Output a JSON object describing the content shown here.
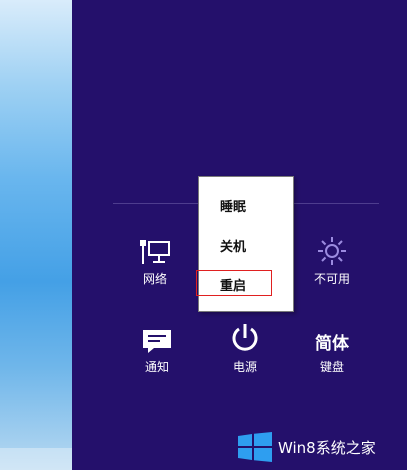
{
  "power_menu": {
    "items": [
      {
        "label": "睡眠"
      },
      {
        "label": "关机"
      },
      {
        "label": "重启"
      }
    ]
  },
  "settings_tiles": {
    "network_label": "网络",
    "brightness_label": "不可用",
    "notifications_label": "通知",
    "power_label": "电源",
    "keyboard_icon_text": "简体",
    "keyboard_label": "键盘"
  },
  "watermark": {
    "text": "Win8系统之家"
  },
  "colors": {
    "charms_bg": "#24106b",
    "menu_bg": "#ffffff",
    "selection_border": "#e02020",
    "brightness_icon": "#9b8be0"
  }
}
